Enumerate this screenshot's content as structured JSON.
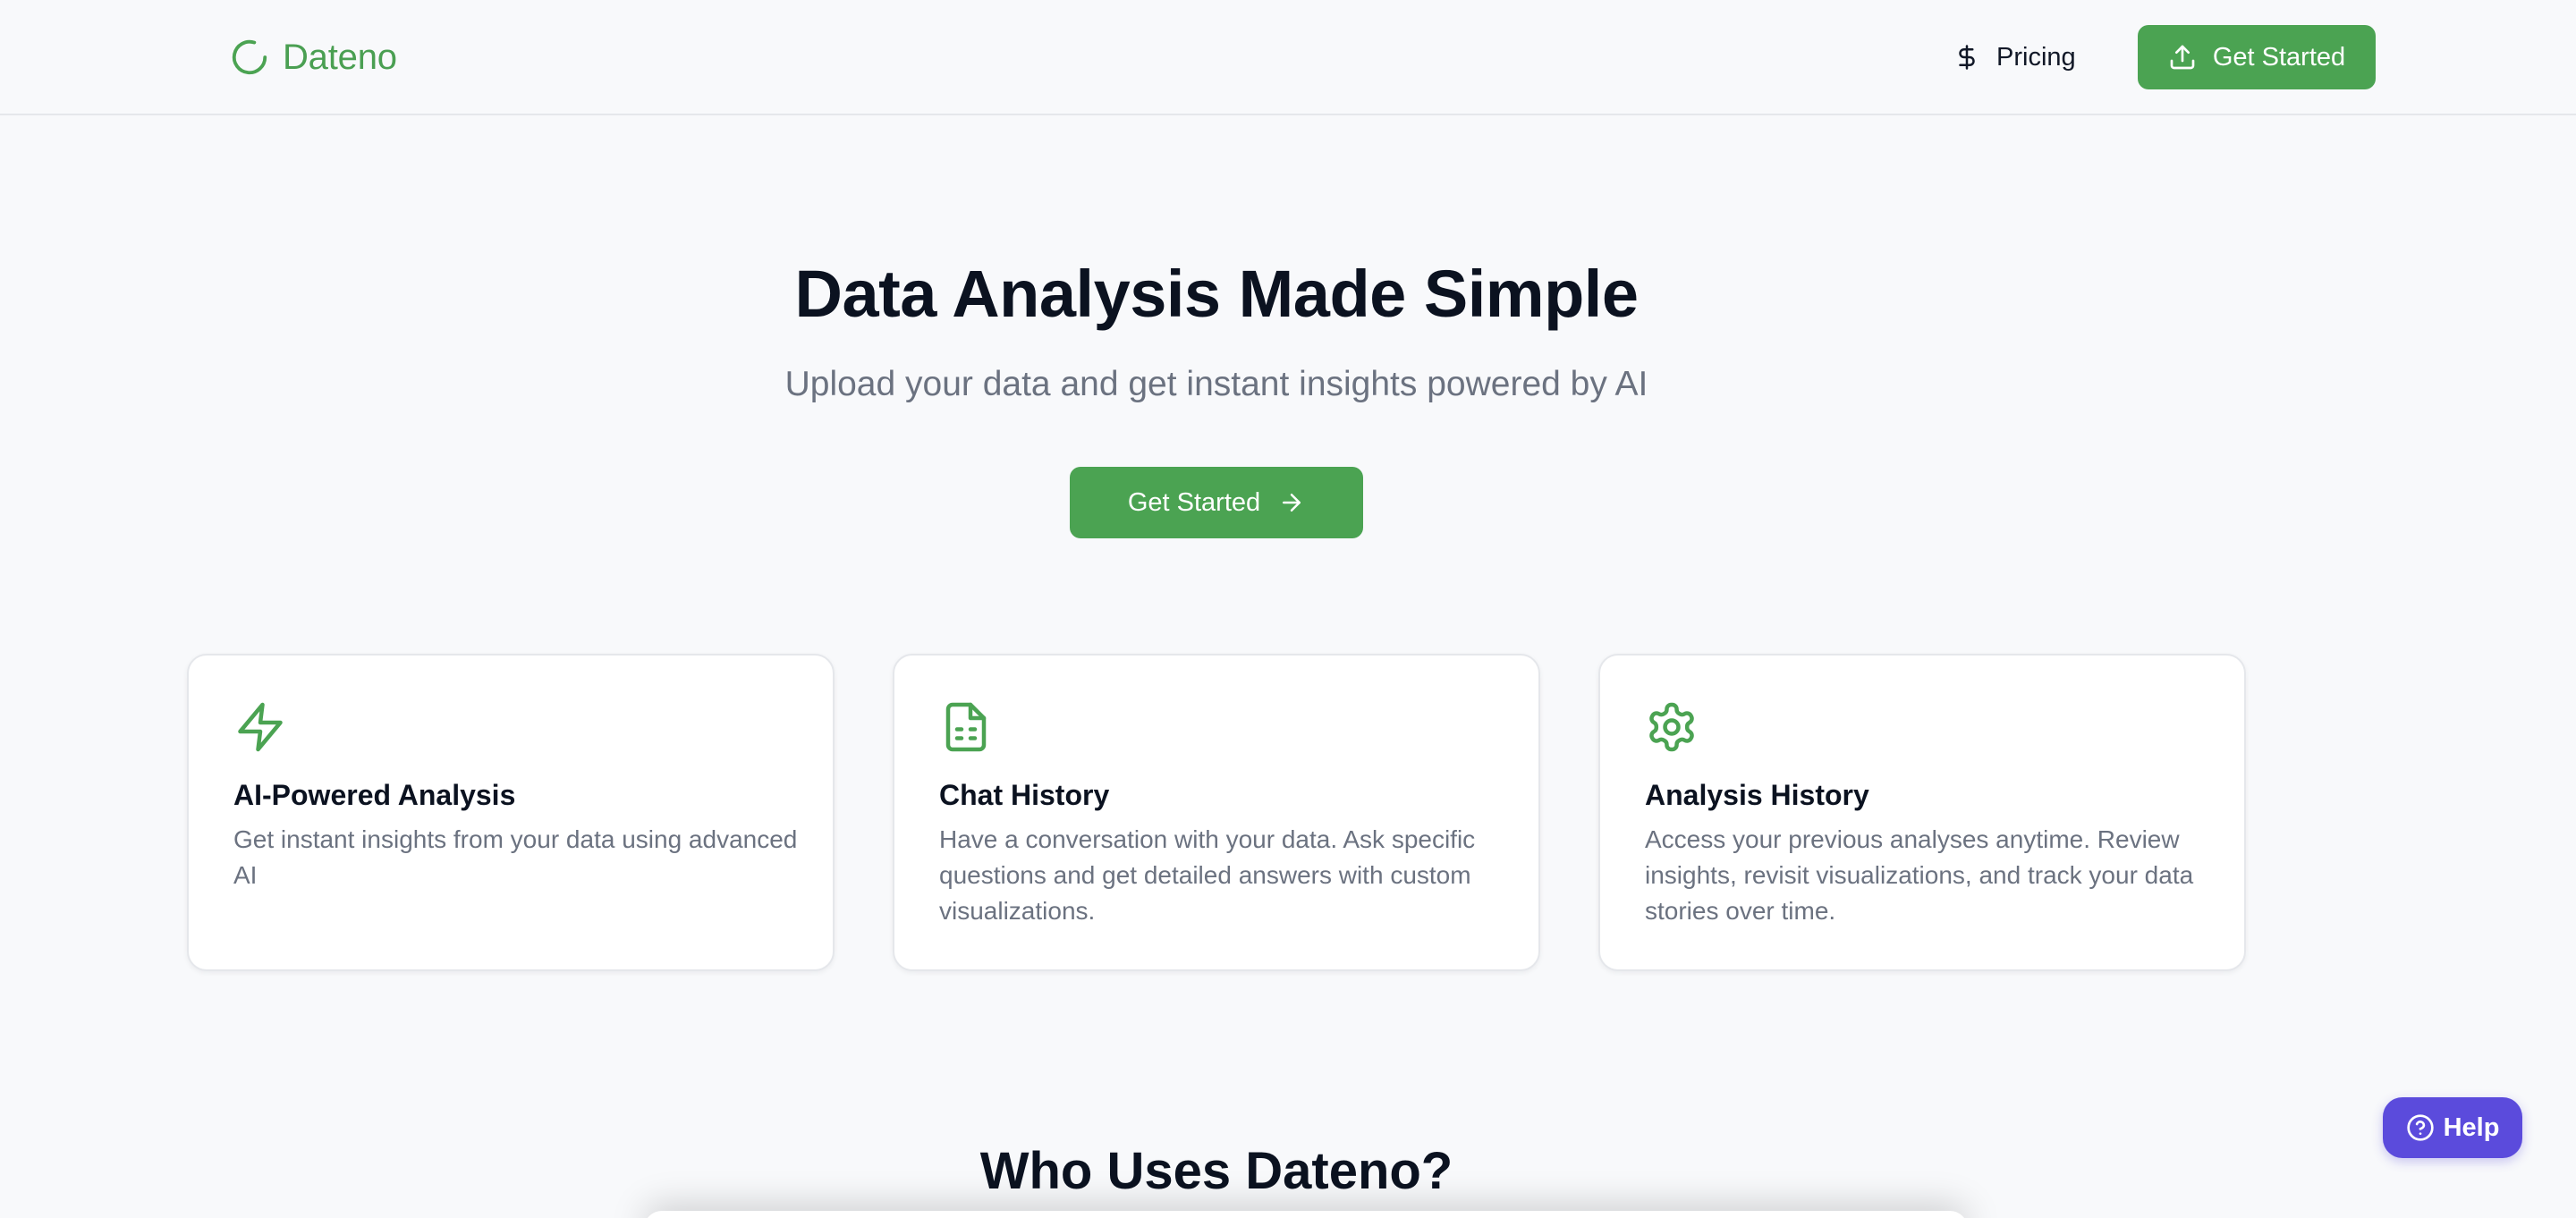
{
  "header": {
    "brand": "Dateno",
    "logo_icon": "loader-circle-icon",
    "nav_pricing_label": "Pricing",
    "nav_pricing_icon": "dollar-sign-icon",
    "cta_label": "Get Started",
    "cta_icon": "upload-icon"
  },
  "hero": {
    "title": "Data Analysis Made Simple",
    "subtitle": "Upload your data and get instant insights powered by AI",
    "cta_label": "Get Started",
    "cta_icon": "arrow-right-icon"
  },
  "features": [
    {
      "icon": "zap-icon",
      "title": "AI-Powered Analysis",
      "description": "Get instant insights from your data using advanced AI"
    },
    {
      "icon": "file-text-icon",
      "title": "Chat History",
      "description": "Have a conversation with your data. Ask specific questions and get detailed answers with custom visualizations."
    },
    {
      "icon": "settings-icon",
      "title": "Analysis History",
      "description": "Access your previous analyses anytime. Review insights, revisit visualizations, and track your data stories over time."
    }
  ],
  "who_uses": {
    "title": "Who Uses Dateno?"
  },
  "help": {
    "label": "Help",
    "icon": "help-circle-icon"
  },
  "colors": {
    "brand_green": "#4ba352",
    "page_background": "#f8f9fb",
    "help_purple": "#5b4bdc",
    "muted_text": "#6b7280"
  }
}
